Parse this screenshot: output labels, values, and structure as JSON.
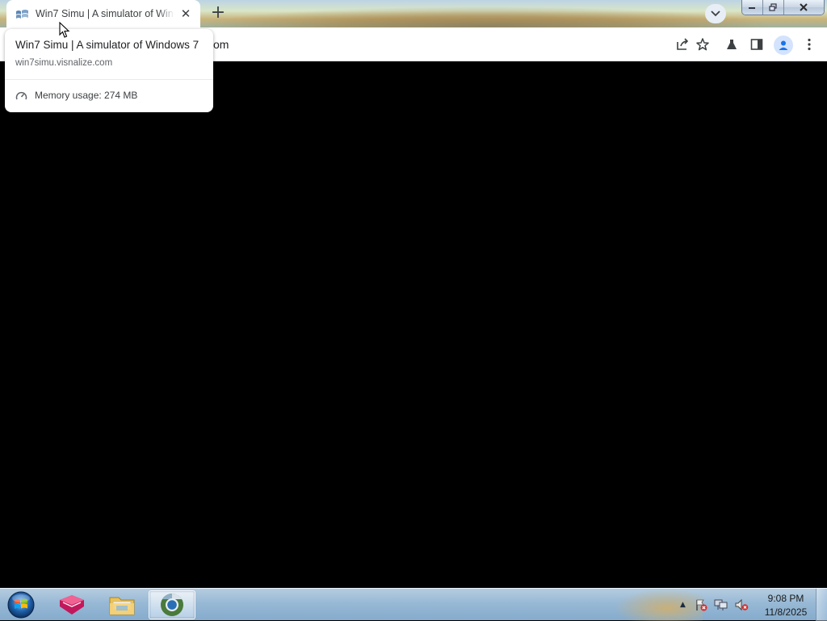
{
  "browser": {
    "tab": {
      "title": "Win7 Simu | A simulator of Windows 7",
      "close_icon": "close-icon",
      "favicon": "windows-flag-icon"
    },
    "new_tab_icon": "plus-icon",
    "tab_search_icon": "chevron-down-icon",
    "omnibox_visible_text": "om",
    "toolbar_icons": [
      "share-icon",
      "star-icon",
      "experiments-flask-icon",
      "side-panel-icon",
      "profile-icon",
      "menu-dots-icon"
    ]
  },
  "hover_card": {
    "title": "Win7 Simu | A simulator of Windows 7",
    "domain": "win7simu.visnalize.com",
    "memory_label": "Memory usage: 274 MB",
    "memory_icon": "gauge-icon"
  },
  "window_controls": [
    "minimize-icon",
    "restore-icon",
    "close-icon"
  ],
  "taskbar": {
    "start_icon": "windows-start-orb-icon",
    "apps": [
      {
        "name": "pink-shield-app-icon",
        "active": false
      },
      {
        "name": "file-explorer-folder-icon",
        "active": false
      },
      {
        "name": "chrome-browser-icon",
        "active": true
      }
    ],
    "tray_icons": [
      "show-hidden-icons-arrow",
      "action-center-flag-icon",
      "network-icon",
      "volume-muted-icon"
    ],
    "clock": {
      "time": "9:08 PM",
      "date": "11/8/2025"
    }
  }
}
